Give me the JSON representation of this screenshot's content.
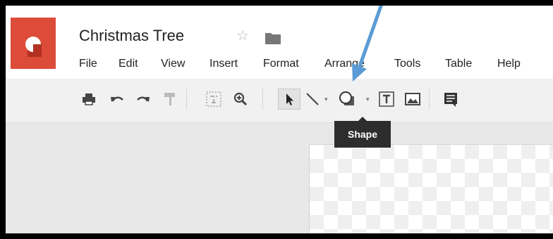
{
  "doc": {
    "title": "Christmas Tree",
    "star_icon": "star-outline-icon",
    "folder_icon": "folder-icon"
  },
  "menu": [
    "File",
    "Edit",
    "View",
    "Insert",
    "Format",
    "Arrange",
    "Tools",
    "Table",
    "Help"
  ],
  "toolbar": {
    "buttons": [
      "print-icon",
      "undo-icon",
      "redo-icon",
      "paint-format-icon",
      "zoom-fit-icon",
      "zoom-in-icon",
      "select-cursor-icon",
      "line-icon",
      "shape-icon",
      "text-box-icon",
      "image-icon",
      "comment-icon"
    ]
  },
  "tooltip": {
    "text": "Shape"
  },
  "colors": {
    "brand": "#dd4b39",
    "annotation_arrow": "#5b9bd5",
    "tooltip_bg": "#2d2d2d"
  }
}
